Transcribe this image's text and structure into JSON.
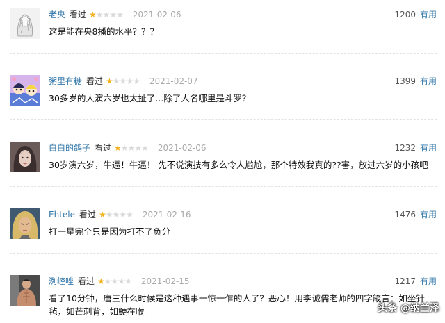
{
  "comments": [
    {
      "user": "老央",
      "status": "看过",
      "stars_filled": 1,
      "stars_total": 5,
      "date": "2021-02-06",
      "votes": "1200",
      "useful": "有用",
      "text": "这是能在央8播的水平？？？"
    },
    {
      "user": "粥里有糖",
      "status": "看过",
      "stars_filled": 1,
      "stars_total": 5,
      "date": "2021-02-07",
      "votes": "1399",
      "useful": "有用",
      "text": "30多岁的人演六岁也太扯了...除了人名哪里是斗罗？"
    },
    {
      "user": "白白的鸽子",
      "status": "看过",
      "stars_filled": 1,
      "stars_total": 5,
      "date": "2021-02-06",
      "votes": "1232",
      "useful": "有用",
      "text": "30岁演六岁，牛逼！牛逼！ 先不说演技有多么令人尴尬，那个特效我真的??害，放过六岁的小孩吧"
    },
    {
      "user": "Ehtele",
      "status": "看过",
      "stars_filled": 1,
      "stars_total": 5,
      "date": "2021-02-16",
      "votes": "1476",
      "useful": "有用",
      "text": "打一星完全只是因为打不了负分"
    },
    {
      "user": "洌崆唑",
      "status": "看过",
      "stars_filled": 1,
      "stars_total": 5,
      "date": "2021-02-15",
      "votes": "1217",
      "useful": "有用",
      "text": "看了10分钟，唐三什么时候是这种遇事一惊一乍的人了？恶心！用李诚儒老师的四字箴言：如坐针毡，如芒刺背，如鲠在喉。"
    }
  ],
  "watermark": "头条 @纳兰泽"
}
